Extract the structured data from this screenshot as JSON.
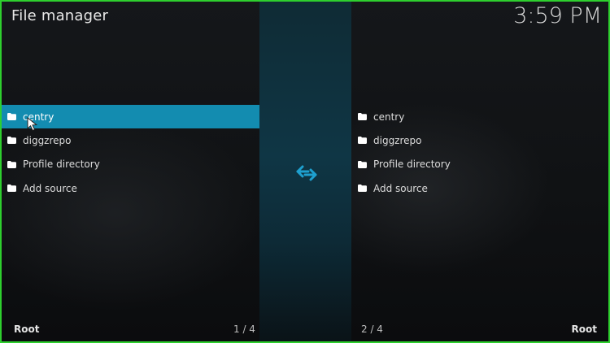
{
  "header": {
    "title": "File manager",
    "clock": "3:59 PM"
  },
  "left_pane": {
    "items": [
      {
        "label": "centry",
        "icon": "folder-icon",
        "selected": true
      },
      {
        "label": "diggzrepo",
        "icon": "folder-icon",
        "selected": false
      },
      {
        "label": "Profile directory",
        "icon": "folder-icon",
        "selected": false
      },
      {
        "label": "Add source",
        "icon": "folder-icon",
        "selected": false
      }
    ],
    "footer_label": "Root",
    "position": "1 / 4"
  },
  "right_pane": {
    "items": [
      {
        "label": "centry",
        "icon": "folder-icon"
      },
      {
        "label": "diggzrepo",
        "icon": "folder-icon"
      },
      {
        "label": "Profile directory",
        "icon": "folder-icon"
      },
      {
        "label": "Add source",
        "icon": "folder-icon"
      }
    ],
    "footer_label": "Root",
    "position": "2 / 4"
  },
  "center": {
    "icon": "swap-arrows-icon"
  },
  "colors": {
    "accent": "#138cb0",
    "frame_border": "#2ecf2e",
    "swap_icon": "#1ea0cf"
  }
}
